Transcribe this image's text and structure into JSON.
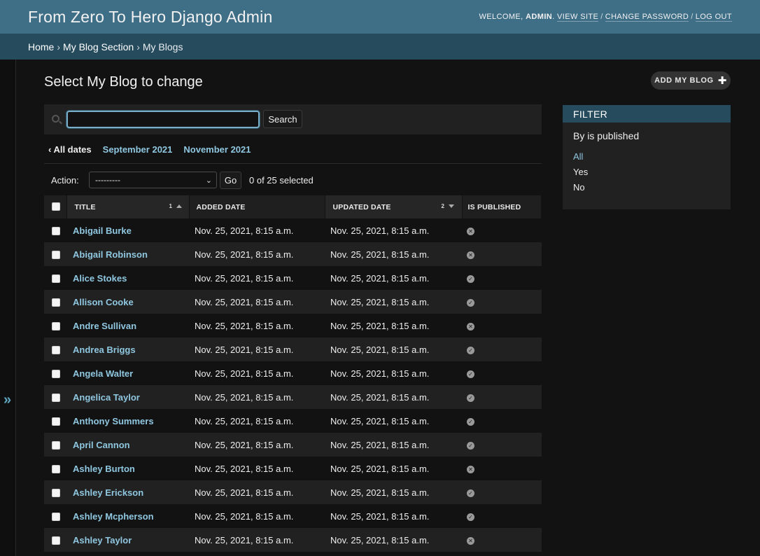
{
  "header": {
    "brand": "From Zero To Hero Django Admin",
    "welcome": "Welcome,",
    "username": "admin",
    "links": [
      "View site",
      "Change password",
      "Log out"
    ]
  },
  "breadcrumbs": [
    "Home",
    "My Blog Section",
    "My Blogs"
  ],
  "page": {
    "title": "Select My Blog to change",
    "add_button": "Add My Blog"
  },
  "search": {
    "value": "",
    "button": "Search"
  },
  "date_hierarchy": {
    "back": "‹ All dates",
    "items": [
      "September 2021",
      "November 2021"
    ]
  },
  "actions": {
    "label": "Action:",
    "selected_option": "---------",
    "go": "Go",
    "counter": "0 of 25 selected"
  },
  "filter": {
    "heading": "Filter",
    "title": "By is published",
    "options": [
      "All",
      "Yes",
      "No"
    ],
    "selected": "All"
  },
  "table": {
    "columns": [
      {
        "label": "Title",
        "sort_priority": "1",
        "sort_dir": "asc"
      },
      {
        "label": "Added date"
      },
      {
        "label": "Updated date",
        "sort_priority": "2",
        "sort_dir": "desc"
      },
      {
        "label": "Is published"
      }
    ],
    "rows": [
      {
        "title": "Abigail Burke",
        "added": "Nov. 25, 2021, 8:15 a.m.",
        "updated": "Nov. 25, 2021, 8:15 a.m.",
        "published": false
      },
      {
        "title": "Abigail Robinson",
        "added": "Nov. 25, 2021, 8:15 a.m.",
        "updated": "Nov. 25, 2021, 8:15 a.m.",
        "published": false
      },
      {
        "title": "Alice Stokes",
        "added": "Nov. 25, 2021, 8:15 a.m.",
        "updated": "Nov. 25, 2021, 8:15 a.m.",
        "published": true
      },
      {
        "title": "Allison Cooke",
        "added": "Nov. 25, 2021, 8:15 a.m.",
        "updated": "Nov. 25, 2021, 8:15 a.m.",
        "published": true
      },
      {
        "title": "Andre Sullivan",
        "added": "Nov. 25, 2021, 8:15 a.m.",
        "updated": "Nov. 25, 2021, 8:15 a.m.",
        "published": false
      },
      {
        "title": "Andrea Briggs",
        "added": "Nov. 25, 2021, 8:15 a.m.",
        "updated": "Nov. 25, 2021, 8:15 a.m.",
        "published": true
      },
      {
        "title": "Angela Walter",
        "added": "Nov. 25, 2021, 8:15 a.m.",
        "updated": "Nov. 25, 2021, 8:15 a.m.",
        "published": true
      },
      {
        "title": "Angelica Taylor",
        "added": "Nov. 25, 2021, 8:15 a.m.",
        "updated": "Nov. 25, 2021, 8:15 a.m.",
        "published": true
      },
      {
        "title": "Anthony Summers",
        "added": "Nov. 25, 2021, 8:15 a.m.",
        "updated": "Nov. 25, 2021, 8:15 a.m.",
        "published": true
      },
      {
        "title": "April Cannon",
        "added": "Nov. 25, 2021, 8:15 a.m.",
        "updated": "Nov. 25, 2021, 8:15 a.m.",
        "published": true
      },
      {
        "title": "Ashley Burton",
        "added": "Nov. 25, 2021, 8:15 a.m.",
        "updated": "Nov. 25, 2021, 8:15 a.m.",
        "published": false
      },
      {
        "title": "Ashley Erickson",
        "added": "Nov. 25, 2021, 8:15 a.m.",
        "updated": "Nov. 25, 2021, 8:15 a.m.",
        "published": true
      },
      {
        "title": "Ashley Mcpherson",
        "added": "Nov. 25, 2021, 8:15 a.m.",
        "updated": "Nov. 25, 2021, 8:15 a.m.",
        "published": true
      },
      {
        "title": "Ashley Taylor",
        "added": "Nov. 25, 2021, 8:15 a.m.",
        "updated": "Nov. 25, 2021, 8:15 a.m.",
        "published": false
      }
    ]
  },
  "icons": {
    "published_true": "check-circle-icon",
    "published_false": "x-circle-icon",
    "nav_toggle": "double-chevron-right-icon"
  }
}
